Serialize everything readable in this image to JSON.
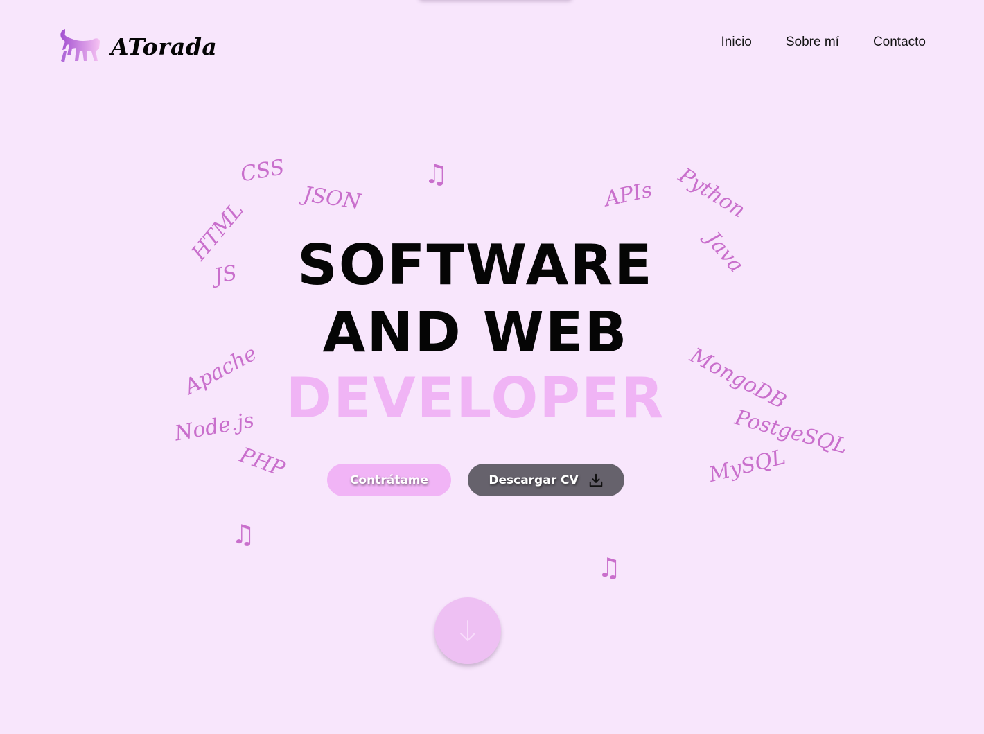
{
  "header": {
    "logo_text": "ATorada",
    "nav": [
      {
        "label": "Inicio"
      },
      {
        "label": "Sobre mí"
      },
      {
        "label": "Contacto"
      }
    ]
  },
  "skills_cloud": [
    {
      "label": "CSS"
    },
    {
      "label": "HTML"
    },
    {
      "label": "JSON"
    },
    {
      "label": "JS"
    },
    {
      "label": "APIs"
    },
    {
      "label": "Python"
    },
    {
      "label": "Java"
    },
    {
      "label": "Apache"
    },
    {
      "label": "Node.js"
    },
    {
      "label": "PHP"
    },
    {
      "label": "MongoDB"
    },
    {
      "label": "PostgeSQL"
    },
    {
      "label": "MySQL"
    }
  ],
  "music_notes": [
    "♫",
    "♫",
    "♫"
  ],
  "hero": {
    "line1": "SOFTWARE",
    "line2": "AND WEB",
    "line3": "DEVELOPER"
  },
  "actions": {
    "hire_label": "Contrátame",
    "cv_label": "Descargar CV"
  },
  "icons": {
    "logo": "cat-icon",
    "download": "download-icon",
    "scroll": "arrow-down-icon"
  },
  "colors": {
    "background": "#f8e6fc",
    "accent_pink": "#f0b4f5",
    "skill_text": "#c96fcc",
    "dark_button": "#66626c",
    "text_dark": "#050505"
  }
}
